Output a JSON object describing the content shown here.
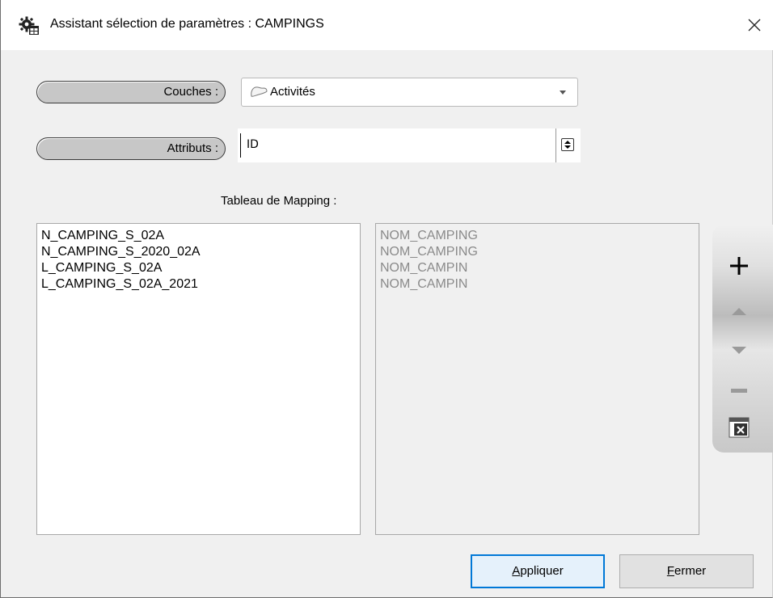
{
  "window": {
    "title": "Assistant sélection de paramètres : CAMPINGS"
  },
  "form": {
    "couches_label": "Couches :",
    "couches_value": "Activités",
    "attributs_label": "Attributs :",
    "attributs_value": "ID",
    "mapping_label": "Tableau de Mapping :"
  },
  "mapping": {
    "left_items": [
      "N_CAMPING_S_02A",
      "N_CAMPING_S_2020_02A",
      "L_CAMPING_S_02A",
      "L_CAMPING_S_02A_2021"
    ],
    "right_items": [
      "NOM_CAMPING",
      "NOM_CAMPING",
      "NOM_CAMPIN",
      "NOM_CAMPIN"
    ]
  },
  "toolbar": {
    "icons": [
      "plus-icon",
      "arrow-up-icon",
      "arrow-down-icon",
      "minus-icon",
      "delete-table-icon"
    ]
  },
  "buttons": {
    "apply_mnemonic": "A",
    "apply_rest": "ppliquer",
    "close_mnemonic": "F",
    "close_rest": "ermer"
  },
  "colors": {
    "accent": "#0078d7",
    "pill_bg": "#c7c7c7",
    "disabled_text": "#8a8a8a"
  }
}
